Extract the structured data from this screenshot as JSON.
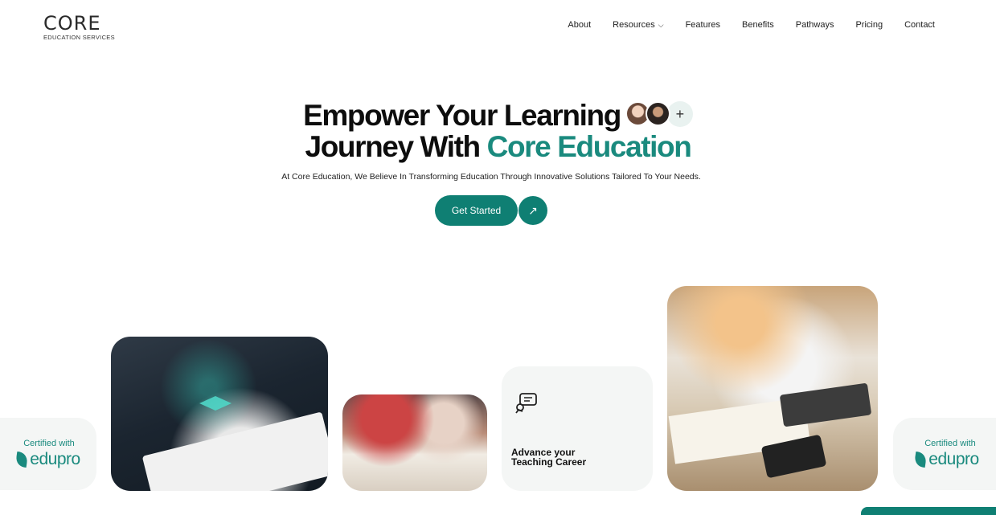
{
  "brand": {
    "name": "CORE",
    "tagline": "EDUCATION SERVICES"
  },
  "nav": {
    "items": [
      {
        "label": "About"
      },
      {
        "label": "Resources",
        "has_dropdown": true
      },
      {
        "label": "Features"
      },
      {
        "label": "Benefits"
      },
      {
        "label": "Pathways"
      },
      {
        "label": "Pricing"
      },
      {
        "label": "Contact"
      }
    ]
  },
  "hero": {
    "title_line1": "Empower Your Learning",
    "title_line2_plain": "Journey With ",
    "title_line2_accent": "Core Education",
    "plus": "+",
    "subtitle": "At Core Education, We Believe In Transforming Education Through Innovative Solutions Tailored To Your Needs.",
    "cta_label": "Get Started",
    "cta_arrow": "↗"
  },
  "cards": {
    "cert_left": {
      "label": "Certified with",
      "brand": "edupro"
    },
    "text_card": {
      "line1": "Advance your",
      "line2": "Teaching Career"
    },
    "cert_right": {
      "label": "Certified with",
      "brand": "edupro"
    }
  },
  "colors": {
    "accent": "#1a8a7e",
    "button": "#0f7f73",
    "card_bg": "#f4f6f5"
  }
}
